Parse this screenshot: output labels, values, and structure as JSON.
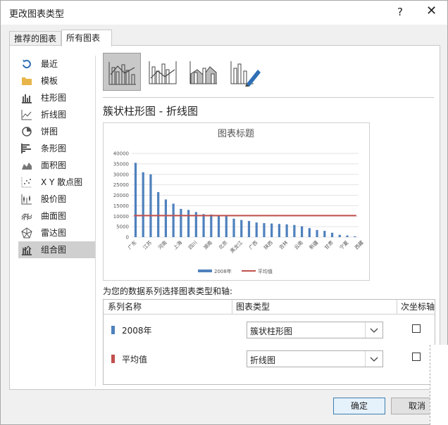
{
  "window": {
    "title": "更改图表类型",
    "help": "?",
    "close": "✕"
  },
  "tabs": [
    {
      "label": "推荐的图表"
    },
    {
      "label": "所有图表"
    }
  ],
  "sidebar": {
    "items": [
      {
        "label": "最近",
        "icon": "recent-icon"
      },
      {
        "label": "模板",
        "icon": "folder-icon"
      },
      {
        "label": "柱形图",
        "icon": "column-chart-icon"
      },
      {
        "label": "折线图",
        "icon": "line-chart-icon"
      },
      {
        "label": "饼图",
        "icon": "pie-chart-icon"
      },
      {
        "label": "条形图",
        "icon": "bar-chart-icon"
      },
      {
        "label": "面积图",
        "icon": "area-chart-icon"
      },
      {
        "label": "X Y 散点图",
        "icon": "scatter-chart-icon"
      },
      {
        "label": "股价图",
        "icon": "stock-chart-icon"
      },
      {
        "label": "曲面图",
        "icon": "surface-chart-icon"
      },
      {
        "label": "雷达图",
        "icon": "radar-chart-icon"
      },
      {
        "label": "组合图",
        "icon": "combo-chart-icon"
      }
    ],
    "selected_index": 11
  },
  "subtypes": [
    "clustered-column-line-icon",
    "clustered-column-line-secondary-icon",
    "stacked-area-column-icon",
    "custom-combination-icon"
  ],
  "heading": "簇状柱形图 - 折线图",
  "chart_data": {
    "type": "bar",
    "title": "图表标题",
    "categories": [
      "广东",
      "江苏",
      "河南",
      "上海",
      "四川",
      "湖南",
      "北京",
      "黑龙江",
      "广西",
      "陕西",
      "吉林",
      "云南",
      "新疆",
      "甘肃",
      "宁夏",
      "西藏"
    ],
    "all_bar_values": [
      35500,
      31000,
      30000,
      21500,
      18000,
      16000,
      13500,
      13000,
      12000,
      11000,
      10800,
      10500,
      10300,
      8800,
      8200,
      7700,
      7000,
      6700,
      6500,
      6300,
      6100,
      5800,
      5200,
      4300,
      3400,
      3000,
      2100,
      1100,
      800,
      400
    ],
    "series": [
      {
        "name": "2008年",
        "type": "bar",
        "color": "#4f81bd"
      },
      {
        "name": "平均值",
        "type": "line",
        "color": "#c0504d",
        "value": 10300
      }
    ],
    "ylim": [
      0,
      40000
    ],
    "yticks": [
      0,
      5000,
      10000,
      15000,
      20000,
      25000,
      30000,
      35000,
      40000
    ],
    "legend": "bottom",
    "grid": true
  },
  "series_section": {
    "label": "为您的数据系列选择图表类型和轴:",
    "headers": {
      "name": "系列名称",
      "type": "图表类型",
      "secondary": "次坐标轴"
    },
    "rows": [
      {
        "name": "2008年",
        "color": "#4f81bd",
        "chart_type": "簇状柱形图",
        "secondary": false
      },
      {
        "name": "平均值",
        "color": "#c0504d",
        "chart_type": "折线图",
        "secondary": false
      }
    ]
  },
  "buttons": {
    "ok": "确定",
    "cancel": "取消"
  }
}
